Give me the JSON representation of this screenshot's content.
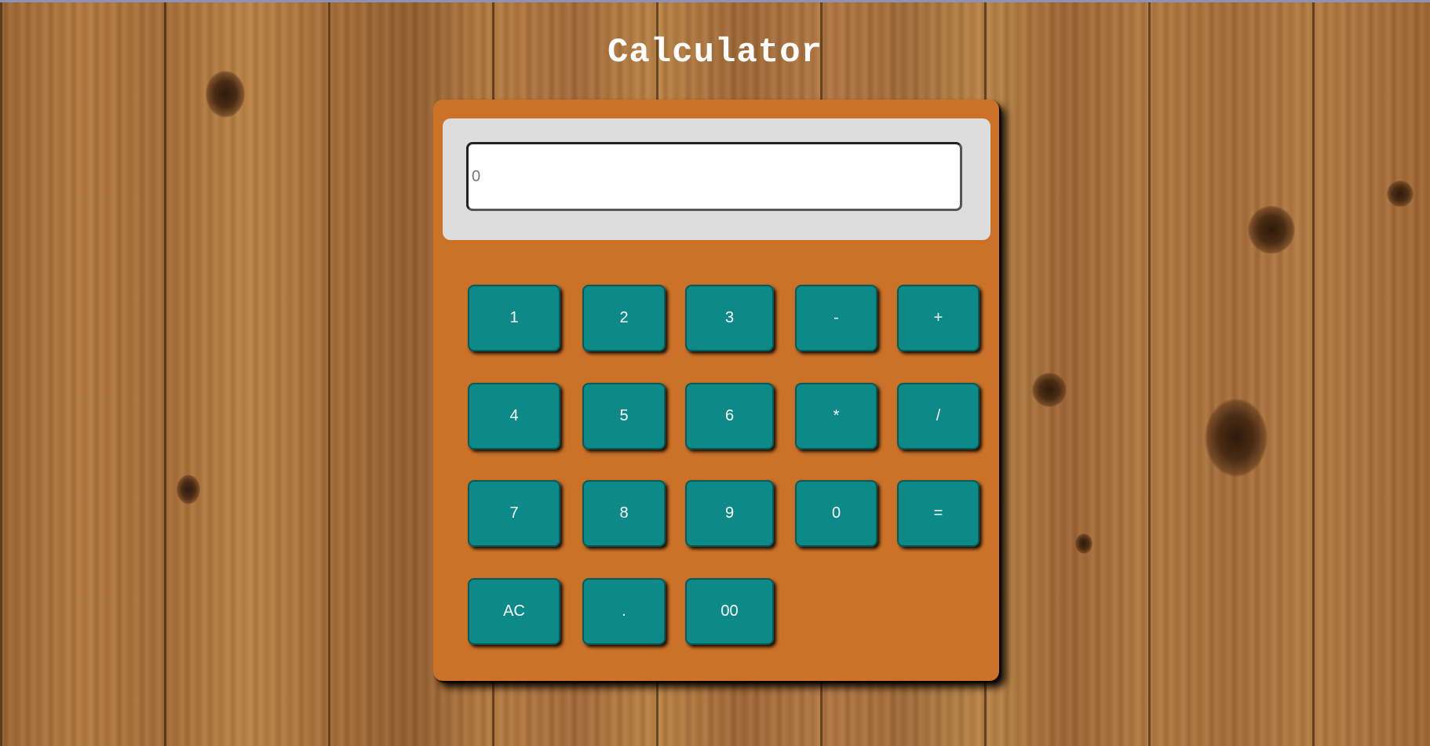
{
  "page": {
    "title": "Calculator"
  },
  "display": {
    "value": "",
    "placeholder": "0"
  },
  "keypad": {
    "rows": [
      [
        "1",
        "2",
        "3",
        "-",
        "+"
      ],
      [
        "4",
        "5",
        "6",
        "*",
        "/"
      ],
      [
        "7",
        "8",
        "9",
        "0",
        "="
      ],
      [
        "AC",
        ".",
        "00"
      ]
    ]
  },
  "colors": {
    "calculator_body": "#cc7228",
    "display_panel": "#dddddd",
    "button": "#0d8a88",
    "button_text": "#ffffff",
    "title_text": "#ffffff"
  }
}
